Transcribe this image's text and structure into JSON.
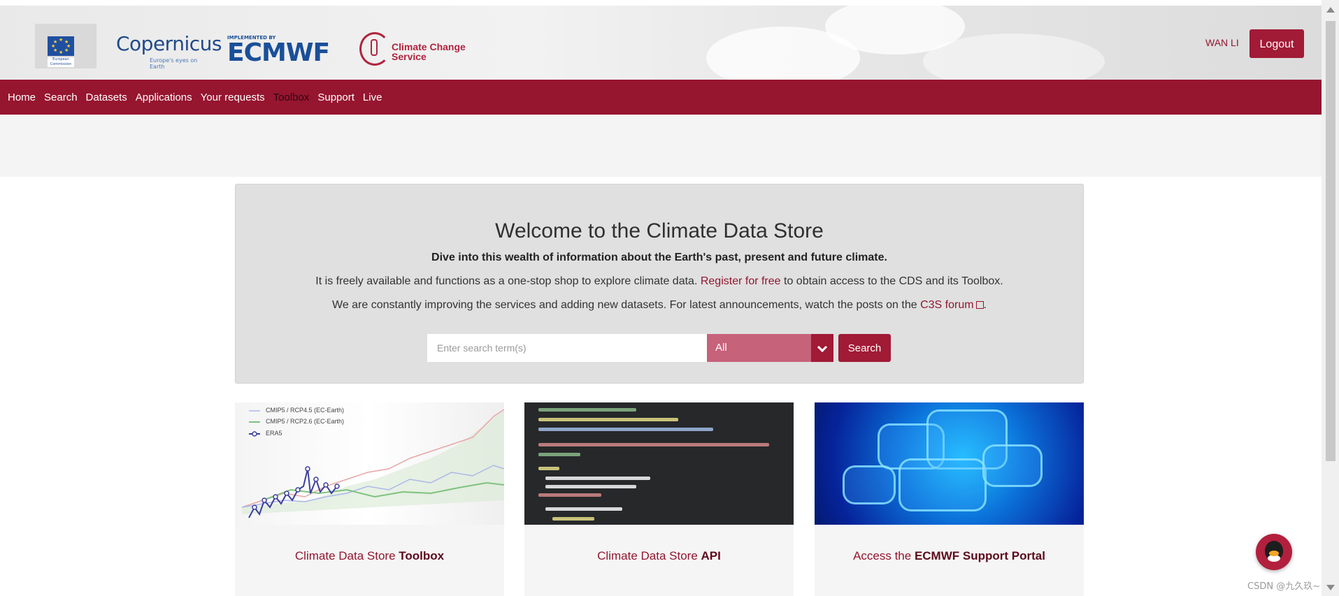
{
  "header": {
    "logos": {
      "eu": "European Commission",
      "copernicus": "Copernicus",
      "copernicus_tagline": "Europe's eyes on Earth",
      "ecmwf_implemented": "IMPLEMENTED BY",
      "ecmwf": "ECMWF",
      "c3s": "Climate Change Service"
    },
    "user_name": "WAN LI",
    "logout_label": "Logout"
  },
  "nav": {
    "items": [
      {
        "label": "Home"
      },
      {
        "label": "Search"
      },
      {
        "label": "Datasets"
      },
      {
        "label": "Applications"
      },
      {
        "label": "Your requests"
      },
      {
        "label": "Toolbox",
        "active": true
      },
      {
        "label": "Support"
      },
      {
        "label": "Live"
      }
    ]
  },
  "hero": {
    "title": "Welcome to the Climate Data Store",
    "subtitle": "Dive into this wealth of information about the Earth's past, present and future climate.",
    "para1_before": "It is freely available and functions as a one-stop shop to explore climate data.",
    "para1_link": "Register for free",
    "para1_after": "to obtain access to the CDS and its Toolbox.",
    "para2_before": "We are constantly improving the services and adding new datasets. For latest announcements, watch the posts on the",
    "para2_link": "C3S forum",
    "para2_after": "."
  },
  "search": {
    "placeholder": "Enter search term(s)",
    "filter_value": "All",
    "button_label": "Search"
  },
  "cards": [
    {
      "title_plain": "Climate Data Store ",
      "title_bold": "Toolbox",
      "legend": [
        "CMIP5 / RCP4.5 (EC-Earth)",
        "CMIP5 / RCP2.6 (EC-Earth)",
        "ERA5"
      ]
    },
    {
      "title_plain": "Climate Data Store ",
      "title_bold": "API"
    },
    {
      "title_plain": "Access the ",
      "title_bold": "ECMWF Support Portal"
    }
  ],
  "colors": {
    "brand": "#96152f",
    "button": "#a11a36",
    "select": "#c6627a"
  },
  "watermark": "CSDN @九久玖~"
}
